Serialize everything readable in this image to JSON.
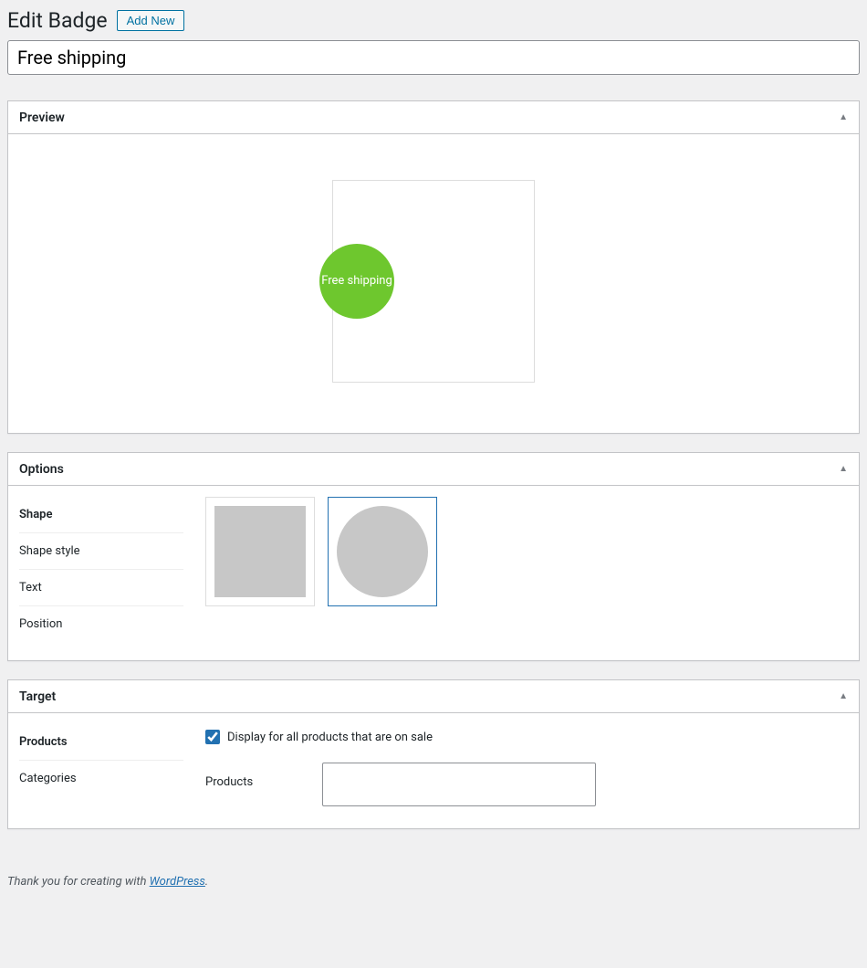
{
  "header": {
    "title": "Edit Badge",
    "addNewLabel": "Add New"
  },
  "titleInput": {
    "value": "Free shipping"
  },
  "preview": {
    "title": "Preview",
    "badge": {
      "text": "Free shipping",
      "bgColor": "#6ec72e"
    }
  },
  "options": {
    "title": "Options",
    "tabs": [
      {
        "label": "Shape",
        "active": true
      },
      {
        "label": "Shape style",
        "active": false
      },
      {
        "label": "Text",
        "active": false
      },
      {
        "label": "Position",
        "active": false
      }
    ],
    "shapeSelected": "circle"
  },
  "target": {
    "title": "Target",
    "tabs": [
      {
        "label": "Products",
        "active": true
      },
      {
        "label": "Categories",
        "active": false
      }
    ],
    "displayAllChecked": true,
    "displayAllLabel": "Display for all products that are on sale",
    "productsLabel": "Products"
  },
  "footer": {
    "prefix": "Thank you for creating with ",
    "linkText": "WordPress",
    "suffix": "."
  }
}
